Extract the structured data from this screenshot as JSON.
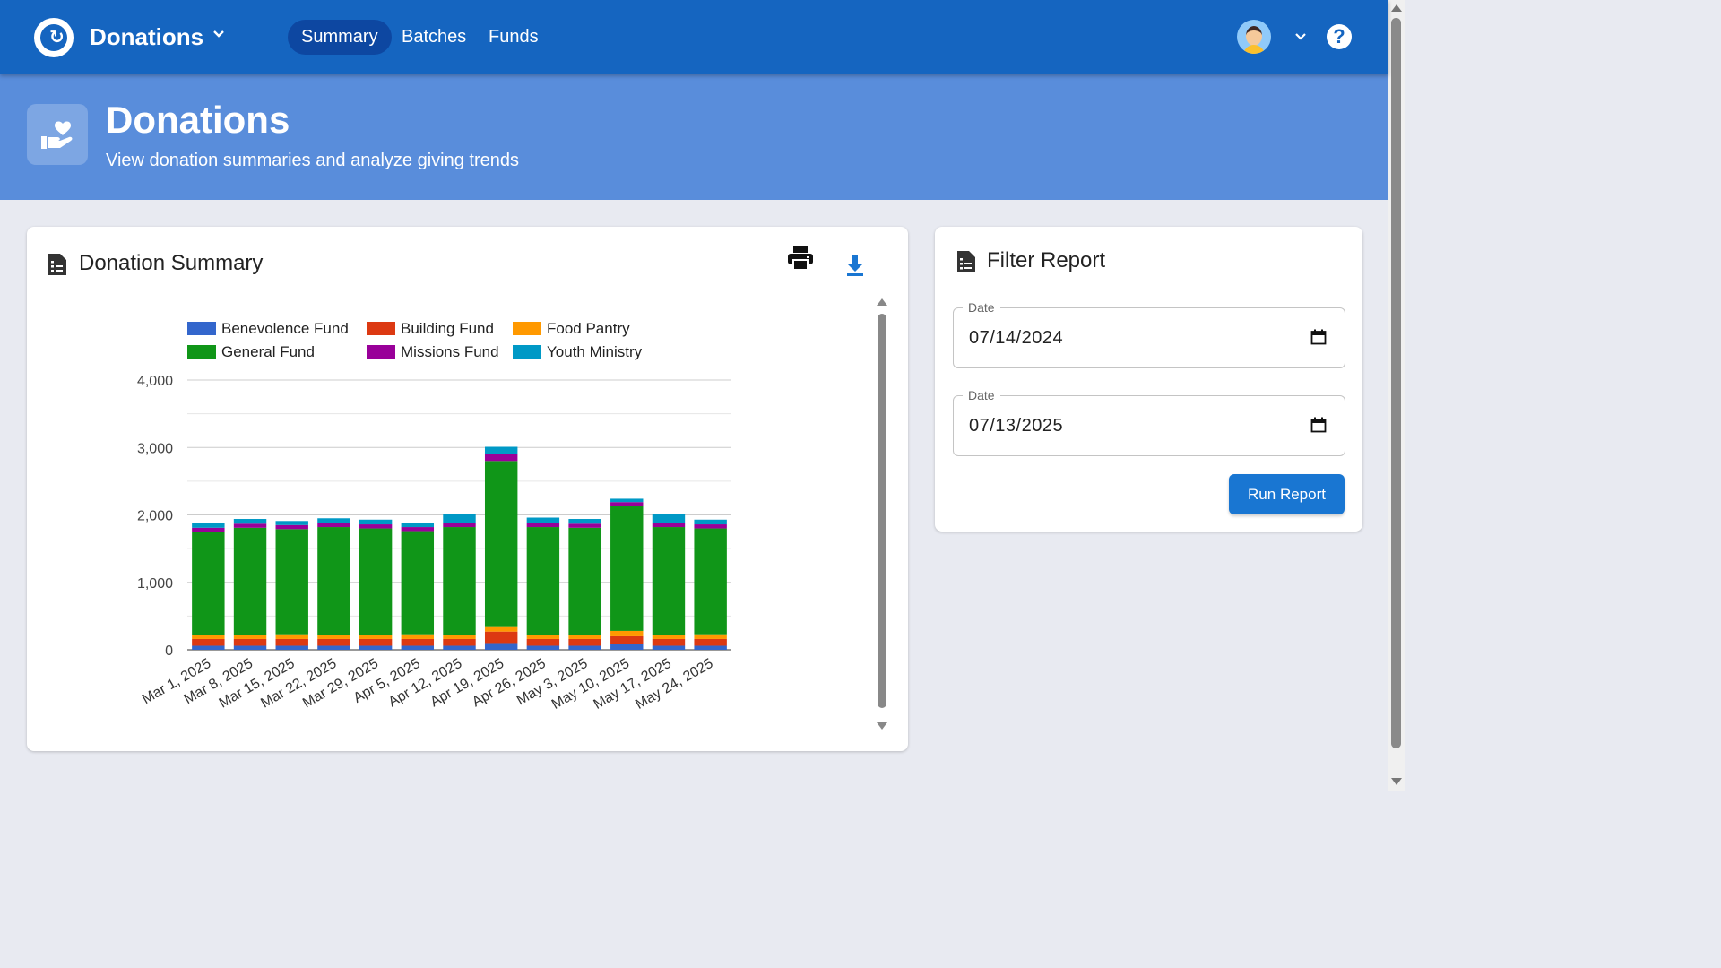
{
  "nav": {
    "app_title": "Donations",
    "items": [
      {
        "label": "Summary",
        "active": true
      },
      {
        "label": "Batches",
        "active": false
      },
      {
        "label": "Funds",
        "active": false
      }
    ],
    "help_label": "?"
  },
  "hero": {
    "title": "Donations",
    "subtitle": "View donation summaries and analyze giving trends"
  },
  "summary": {
    "title": "Donation Summary",
    "actions": [
      "print-icon",
      "download-icon"
    ]
  },
  "filter": {
    "title": "Filter Report",
    "start_date": {
      "label": "Date",
      "value": "07/14/2024"
    },
    "end_date": {
      "label": "Date",
      "value": "07/13/2025"
    },
    "run_label": "Run Report"
  },
  "colors": {
    "nav_bg": "#1565c0",
    "hero_bg": "#598ddb",
    "button": "#1976d2"
  },
  "chart_data": {
    "type": "bar",
    "stacked": true,
    "categories": [
      "Mar 1, 2025",
      "Mar 8, 2025",
      "Mar 15, 2025",
      "Mar 22, 2025",
      "Mar 29, 2025",
      "Apr 5, 2025",
      "Apr 12, 2025",
      "Apr 19, 2025",
      "Apr 26, 2025",
      "May 3, 2025",
      "May 10, 2025",
      "May 17, 2025",
      "May 24, 2025"
    ],
    "ylim": [
      0,
      4000
    ],
    "yticks": [
      0,
      1000,
      2000,
      3000,
      4000
    ],
    "ytick_labels": [
      "0",
      "1,000",
      "2,000",
      "3,000",
      "4,000"
    ],
    "grid": true,
    "legend_position": "top",
    "series": [
      {
        "name": "Benevolence Fund",
        "color": "#3366cc",
        "values": [
          60,
          60,
          60,
          60,
          60,
          60,
          60,
          100,
          60,
          60,
          90,
          60,
          60
        ]
      },
      {
        "name": "Building Fund",
        "color": "#dc3912",
        "values": [
          100,
          100,
          100,
          100,
          100,
          100,
          100,
          170,
          100,
          100,
          110,
          100,
          100
        ]
      },
      {
        "name": "Food Pantry",
        "color": "#ff9900",
        "values": [
          60,
          60,
          70,
          60,
          60,
          70,
          60,
          80,
          60,
          60,
          80,
          60,
          70
        ]
      },
      {
        "name": "General Fund",
        "color": "#109618",
        "values": [
          1530,
          1590,
          1560,
          1600,
          1580,
          1530,
          1600,
          2450,
          1600,
          1590,
          1850,
          1600,
          1570
        ]
      },
      {
        "name": "Missions Fund",
        "color": "#990099",
        "values": [
          60,
          60,
          60,
          60,
          60,
          60,
          60,
          100,
          60,
          60,
          60,
          60,
          60
        ]
      },
      {
        "name": "Youth Ministry",
        "color": "#0099c6",
        "values": [
          70,
          70,
          60,
          70,
          70,
          60,
          130,
          110,
          80,
          70,
          50,
          130,
          70
        ]
      }
    ]
  }
}
